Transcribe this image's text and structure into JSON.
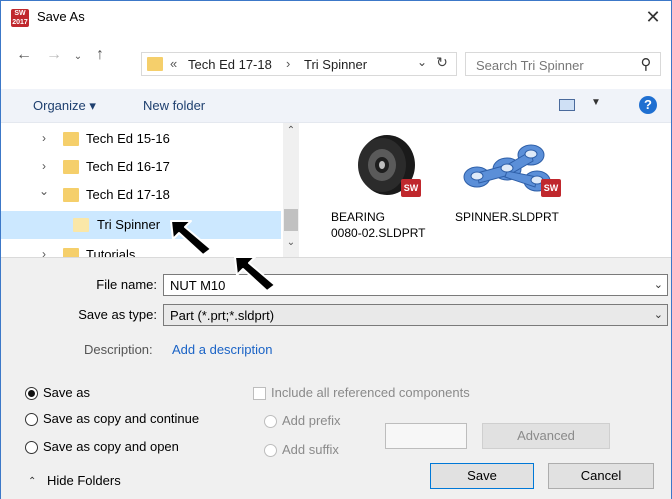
{
  "window": {
    "title": "Save As",
    "app_icon_text": "SW 2017"
  },
  "address": {
    "overflow": "«",
    "crumbs": [
      "Tech Ed 17-18",
      "Tri Spinner"
    ],
    "separator": "›"
  },
  "search": {
    "placeholder": "Search Tri Spinner"
  },
  "toolbar": {
    "organize_label": "Organize ▾",
    "new_folder_label": "New folder"
  },
  "tree": {
    "items": [
      {
        "label": "Tech Ed 15-16",
        "chevron": "›"
      },
      {
        "label": "Tech Ed 16-17",
        "chevron": "›"
      },
      {
        "label": "Tech Ed 17-18",
        "chevron": "⌄"
      },
      {
        "label": "Tri Spinner",
        "chevron": ""
      },
      {
        "label": "Tutorials",
        "chevron": "›"
      }
    ],
    "selected": "Tri Spinner"
  },
  "files": [
    {
      "name": "BEARING 0080-02.SLDPRT",
      "line1": "BEARING",
      "line2": "0080-02.SLDPRT",
      "badge": "SW"
    },
    {
      "name": "SPINNER.SLDPRT",
      "line1": "SPINNER.SLDPRT",
      "line2": "",
      "badge": "SW"
    }
  ],
  "form": {
    "file_name_label": "File name:",
    "file_name_value": "NUT M10",
    "save_type_label": "Save as type:",
    "save_type_value": "Part (*.prt;*.sldprt)",
    "description_label": "Description:",
    "description_link": "Add a description"
  },
  "options": {
    "save_as": "Save as",
    "save_copy_continue": "Save as copy and continue",
    "save_copy_open": "Save as copy and open",
    "include_refs": "Include all referenced components",
    "add_prefix": "Add prefix",
    "add_suffix": "Add suffix",
    "selected": "Save as"
  },
  "buttons": {
    "advanced": "Advanced",
    "save": "Save",
    "cancel": "Cancel",
    "hide_folders": "Hide Folders"
  },
  "colors": {
    "selection": "#cce8ff",
    "folder": "#f5cf6b",
    "link": "#1a63c6",
    "primary_border": "#0078d7",
    "solidworks_red": "#c0282d"
  }
}
